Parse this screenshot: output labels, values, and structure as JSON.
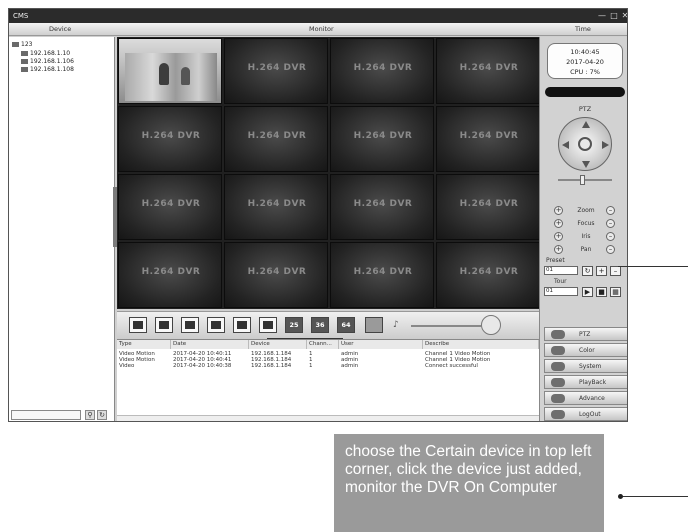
{
  "window": {
    "title": "CMS",
    "controls": [
      "—",
      "□",
      "✕"
    ]
  },
  "header": {
    "device_label": "Device",
    "monitor_label": "Monitor",
    "time_label": "Time"
  },
  "device_tree": {
    "root": "123",
    "devices": [
      "192.168.1.10",
      "192.168.1.106",
      "192.168.1.108"
    ]
  },
  "video_grid": {
    "tile_label": "H.264 DVR",
    "live_tile_index": 0,
    "rows": 4,
    "cols": 4
  },
  "layout_toolbar": {
    "layouts": [
      "1",
      "4",
      "6",
      "9",
      "8",
      "16",
      "25",
      "36",
      "64"
    ],
    "number_labels": [
      "25",
      "36",
      "64"
    ]
  },
  "log": {
    "columns": [
      "Type",
      "Date",
      "Device",
      "Chann...",
      "User",
      "Describe"
    ],
    "rows": [
      [
        "Video Motion",
        "2017-04-20 10:40:11",
        "192.168.1.184",
        "1",
        "admin",
        "Channel 1 Video Motion"
      ],
      [
        "Video Motion",
        "2017-04-20 10:40:41",
        "192.168.1.184",
        "1",
        "admin",
        "Channel 1 Video Motion"
      ],
      [
        "Video",
        "2017-04-20 10:40:38",
        "192.168.1.184",
        "1",
        "admin",
        "Connect successful"
      ]
    ]
  },
  "status": {
    "time": "10:40:45",
    "date": "2017-04-20",
    "cpu": "CPU : 7%"
  },
  "ptz": {
    "title": "PTZ",
    "controls": [
      "Zoom",
      "Focus",
      "Iris",
      "Pan"
    ],
    "preset_label": "Preset",
    "preset_value": "01",
    "tour_label": "Tour",
    "tour_value": "01"
  },
  "menu": {
    "items": [
      "PTZ",
      "Color",
      "System",
      "PlayBack",
      "Advance",
      "LogOut"
    ]
  },
  "callout": {
    "text": "choose the Certain device in top left corner, click the device just added, monitor the DVR On Computer"
  },
  "colors": {
    "title_bar": "#2b2b2b",
    "callout_bg": "#9a9a9a",
    "panel_bg": "#d2d2d2"
  }
}
